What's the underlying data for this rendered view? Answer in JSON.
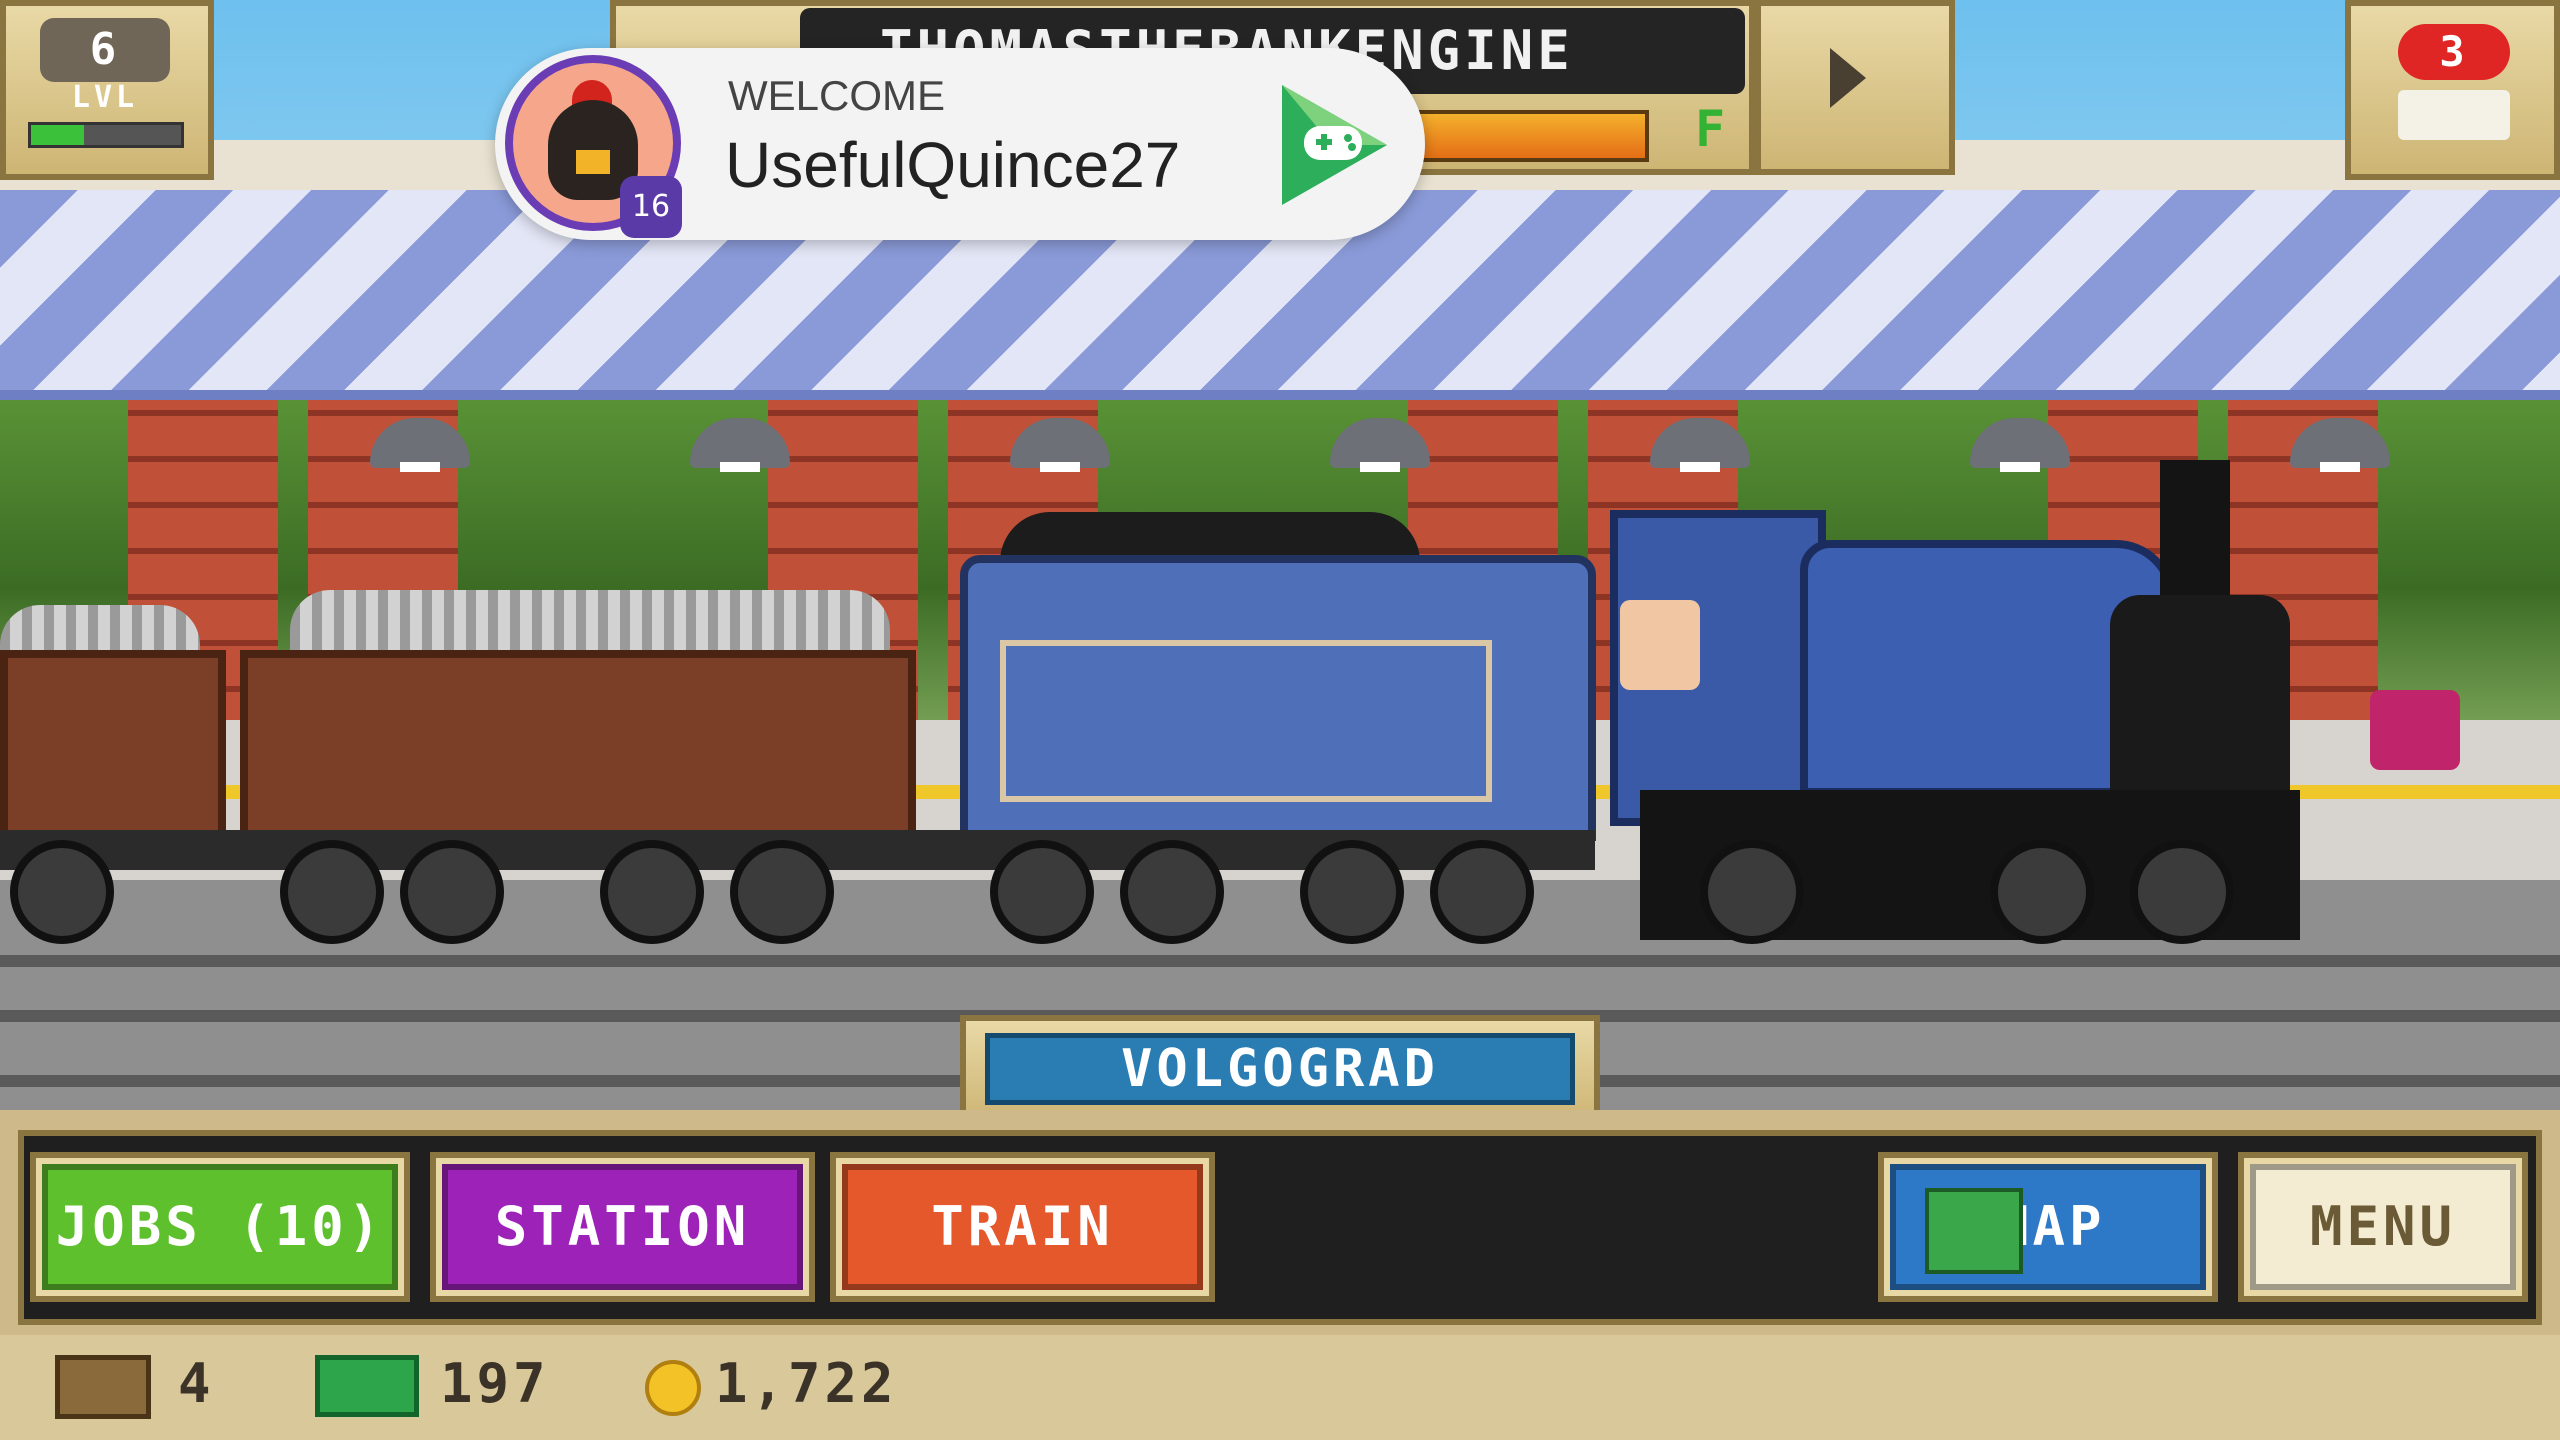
{
  "hud": {
    "level": "6",
    "level_label": "LVL",
    "xp_fraction": 0.35,
    "train_name": "THOMASTHEBANKENGINE",
    "fuel_label": "F",
    "fuel_fraction": 0.85,
    "trains_count": "3"
  },
  "toast": {
    "welcome_label": "WELCOME",
    "player_name": "UsefulQuince27",
    "player_level": "16"
  },
  "station": {
    "name": "VOLGOGRAD"
  },
  "buttons": {
    "jobs": "JOBS (10)",
    "station": "STATION",
    "train": "TRAIN",
    "map": "MAP",
    "menu": "MENU"
  },
  "resources": {
    "crates": "4",
    "cash": "197",
    "coins": "1,722"
  },
  "colors": {
    "jobs": "#5fc02e",
    "station": "#9c22b8",
    "train": "#e4582c",
    "map": "#2d78c7",
    "menu": "#f4ecd2"
  },
  "icons": {
    "level": "hexagon-badge",
    "play": "play-arrow-icon",
    "trains": "locomotive-icon",
    "games": "google-play-games-icon",
    "crate": "crate-icon",
    "cash": "cash-icon",
    "coin": "coin-icon"
  }
}
